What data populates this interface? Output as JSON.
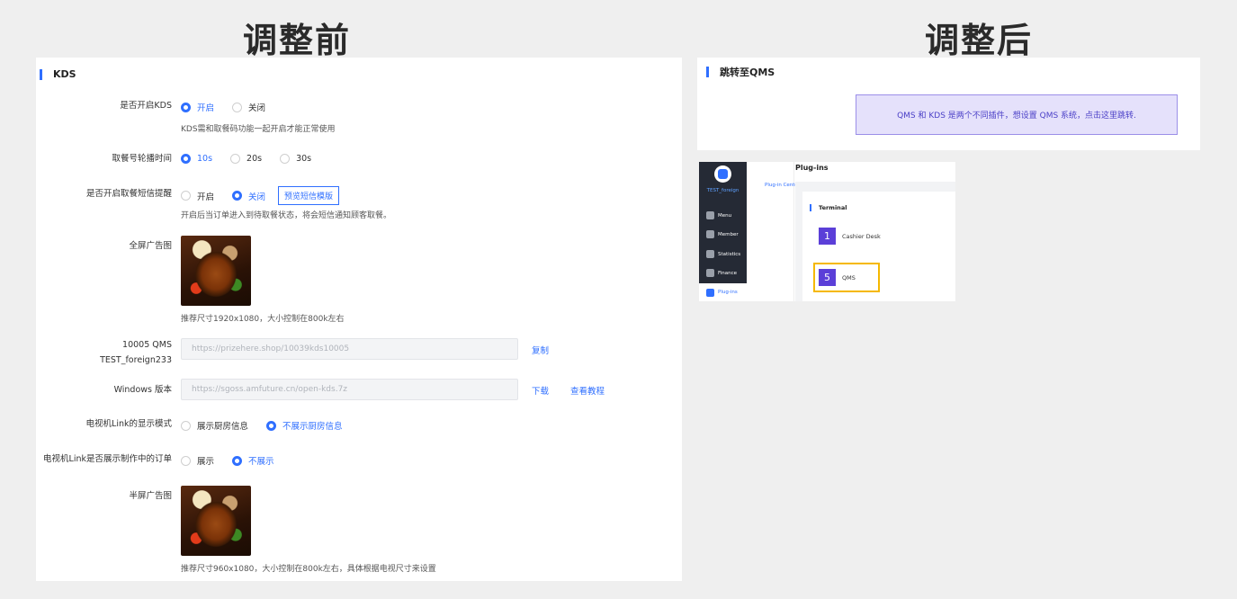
{
  "titles": {
    "before": "调整前",
    "after": "调整后"
  },
  "before": {
    "section_title": "KDS",
    "enable_kds": {
      "label": "是否开启KDS",
      "options": [
        "开启",
        "关闭"
      ],
      "selected": 0,
      "hint": "KDS需和取餐码功能一起开启才能正常使用"
    },
    "rotation": {
      "label": "取餐号轮播时间",
      "options": [
        "10s",
        "20s",
        "30s"
      ],
      "selected": 0
    },
    "sms": {
      "label": "是否开启取餐短信提醒",
      "options": [
        "开启",
        "关闭"
      ],
      "selected": 1,
      "button": "预览短信模版",
      "hint": "开启后当订单进入到待取餐状态，将会短信通知顾客取餐。"
    },
    "fullscreen_ad": {
      "label": "全屏广告图",
      "hint": "推荐尺寸1920x1080，大小控制在800k左右"
    },
    "qms_link": {
      "label_line1": "10005 QMS",
      "label_line2": "TEST_foreign233",
      "value": "https://prizehere.shop/10039kds10005",
      "action": "复制"
    },
    "windows": {
      "label": "Windows 版本",
      "value": "https://sgoss.amfuture.cn/open-kds.7z",
      "download": "下载",
      "tutorial": "查看教程"
    },
    "tv_mode": {
      "label": "电视机Link的显示模式",
      "options": [
        "展示厨房信息",
        "不展示厨房信息"
      ],
      "selected": 1
    },
    "tv_making": {
      "label": "电视机Link是否展示制作中的订单",
      "options": [
        "展示",
        "不展示"
      ],
      "selected": 1
    },
    "half_ad": {
      "label": "半屏广告图",
      "hint": "推荐尺寸960x1080，大小控制在800k左右，具体根据电视尺寸来设置"
    }
  },
  "after": {
    "section_title": "跳转至QMS",
    "banner": "QMS 和 KDS 是两个不同插件，想设置 QMS 系统，点击这里跳转."
  },
  "mini_app": {
    "user": "TEST_foreign",
    "nav": [
      "Menu",
      "Member",
      "Statistics",
      "Finance"
    ],
    "plugins": "Plug-ins",
    "plugin_center": "Plug-in Center",
    "page_title": "Plug-ins",
    "terminal": "Terminal",
    "tiles": [
      {
        "num": "1",
        "label": "Cashier Desk"
      },
      {
        "num": "5",
        "label": "QMS"
      }
    ]
  },
  "colors": {
    "accent": "#2f6fff",
    "purple": "#5b3fd8",
    "highlight": "#f5b800"
  }
}
